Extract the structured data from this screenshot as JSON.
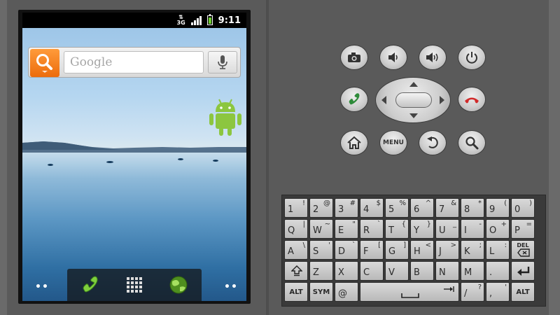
{
  "status_bar": {
    "network": "3G",
    "time": "9:11"
  },
  "search_widget": {
    "placeholder": "Google"
  },
  "dock": {
    "left_dots": "••",
    "right_dots": "••"
  },
  "controls": {
    "menu_label": "MENU"
  },
  "colors": {
    "search_orange": "#f08020",
    "android_green": "#8cc63f",
    "call_green": "#2e8b3a",
    "end_red": "#d12a2a"
  },
  "icons": [
    "camera-icon",
    "volume-down-icon",
    "volume-up-icon",
    "power-icon",
    "call-icon",
    "end-call-icon",
    "home-icon",
    "back-icon",
    "search-icon",
    "phone-icon",
    "apps-grid-icon",
    "browser-globe-icon",
    "microphone-icon",
    "android-icon"
  ],
  "keyboard": {
    "rows": [
      [
        [
          "1",
          "!"
        ],
        [
          "2",
          "@"
        ],
        [
          "3",
          "#"
        ],
        [
          "4",
          "$"
        ],
        [
          "5",
          "%"
        ],
        [
          "6",
          "^"
        ],
        [
          "7",
          "&"
        ],
        [
          "8",
          "*"
        ],
        [
          "9",
          "("
        ],
        [
          "0",
          ")"
        ]
      ],
      [
        [
          "Q",
          "|"
        ],
        [
          "W",
          "~"
        ],
        [
          "E",
          "\""
        ],
        [
          "R",
          "`"
        ],
        [
          "T",
          "{"
        ],
        [
          "Y",
          "}"
        ],
        [
          "U",
          "_"
        ],
        [
          "I",
          "-"
        ],
        [
          "O",
          "+"
        ],
        [
          "P",
          "="
        ]
      ],
      [
        [
          "A",
          "\\"
        ],
        [
          "S",
          "'"
        ],
        [
          "D",
          "`"
        ],
        [
          "F",
          "["
        ],
        [
          "G",
          "]"
        ],
        [
          "H",
          "<"
        ],
        [
          "J",
          ">"
        ],
        [
          "K",
          ";"
        ],
        [
          "L",
          ":"
        ]
      ],
      [
        [
          "Z",
          ""
        ],
        [
          "X",
          ""
        ],
        [
          "C",
          ""
        ],
        [
          "V",
          ""
        ],
        [
          "B",
          ""
        ],
        [
          "N",
          ""
        ],
        [
          "M",
          ""
        ],
        [
          ".",
          ""
        ]
      ]
    ],
    "del_label": "DEL",
    "alt_label": "ALT",
    "sym_label": "SYM",
    "at_label": "@",
    "slash_main": "/",
    "slash_alt": "?",
    "comma_main": ",",
    "comma_alt": "'"
  }
}
